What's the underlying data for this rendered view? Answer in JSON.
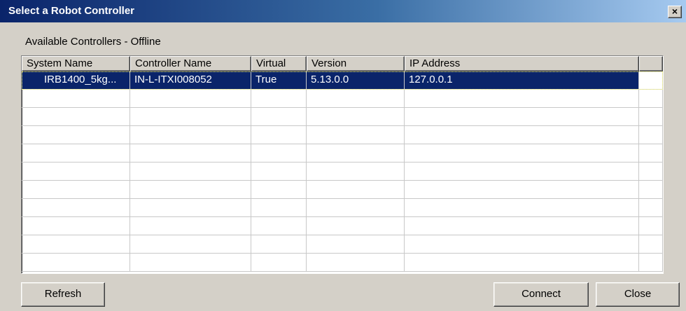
{
  "window": {
    "title": "Select a Robot Controller",
    "close_glyph": "×"
  },
  "group": {
    "label": "Available Controllers - Offline"
  },
  "table": {
    "columns": [
      "System Name",
      "Controller Name",
      "Virtual",
      "Version",
      "IP Address",
      ""
    ],
    "rows": [
      {
        "system_name": "IRB1400_5kg...",
        "controller_name": "IN-L-ITXI008052",
        "virtual": "True",
        "version": "5.13.0.0",
        "ip_address": "127.0.0.1",
        "selected": true
      }
    ],
    "empty_rows": 10
  },
  "buttons": {
    "refresh": "Refresh",
    "connect": "Connect",
    "close": "Close"
  },
  "colors": {
    "selection": "#0a246a",
    "face": "#d4d0c8"
  }
}
